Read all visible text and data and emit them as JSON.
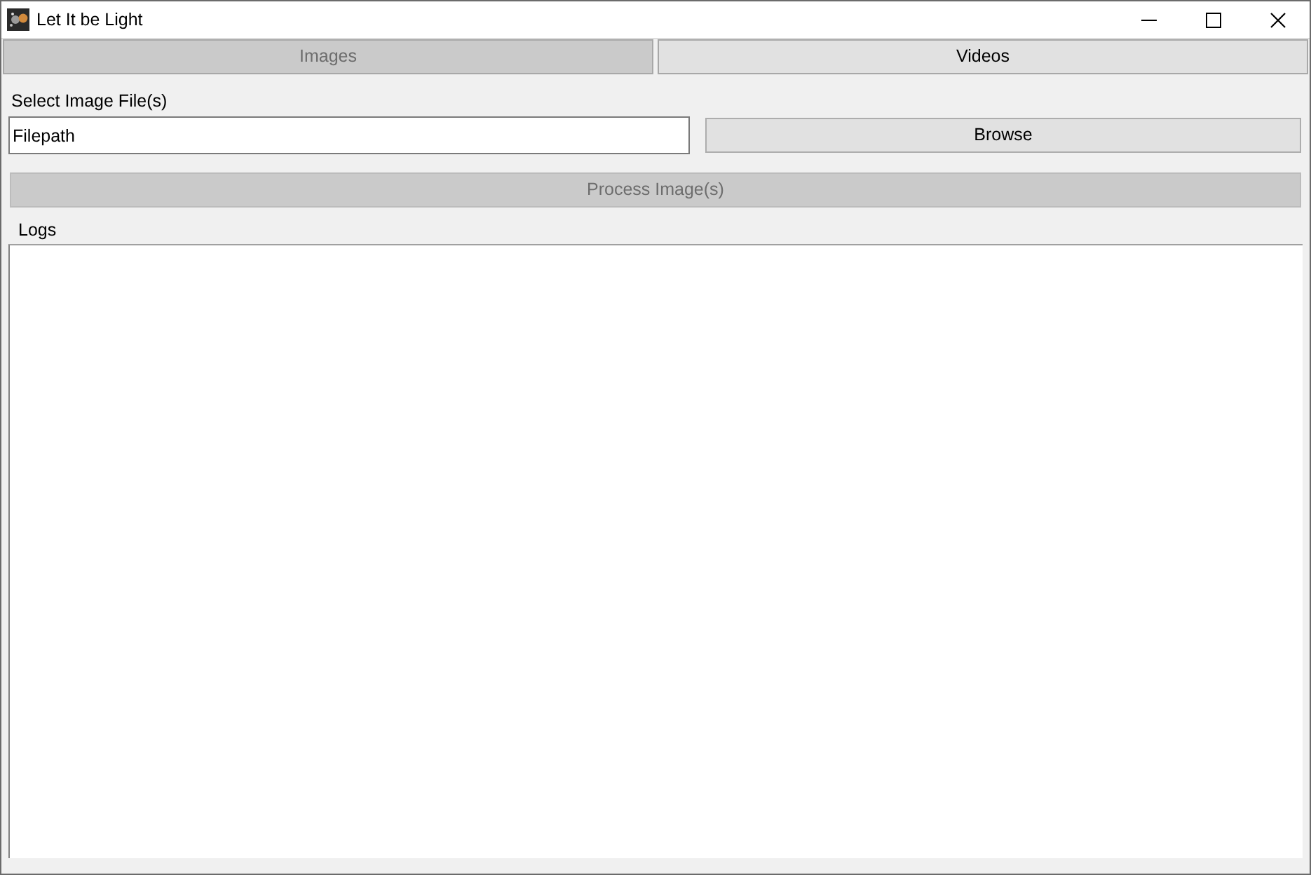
{
  "window": {
    "title": "Let It be Light"
  },
  "tabs": [
    {
      "label": "Images",
      "selected": true
    },
    {
      "label": "Videos",
      "selected": false
    }
  ],
  "file_select": {
    "label": "Select Image File(s)",
    "value": "Filepath",
    "browse_button": "Browse"
  },
  "process_button": {
    "label": "Process Image(s)",
    "disabled": true
  },
  "logs": {
    "label": "Logs"
  }
}
